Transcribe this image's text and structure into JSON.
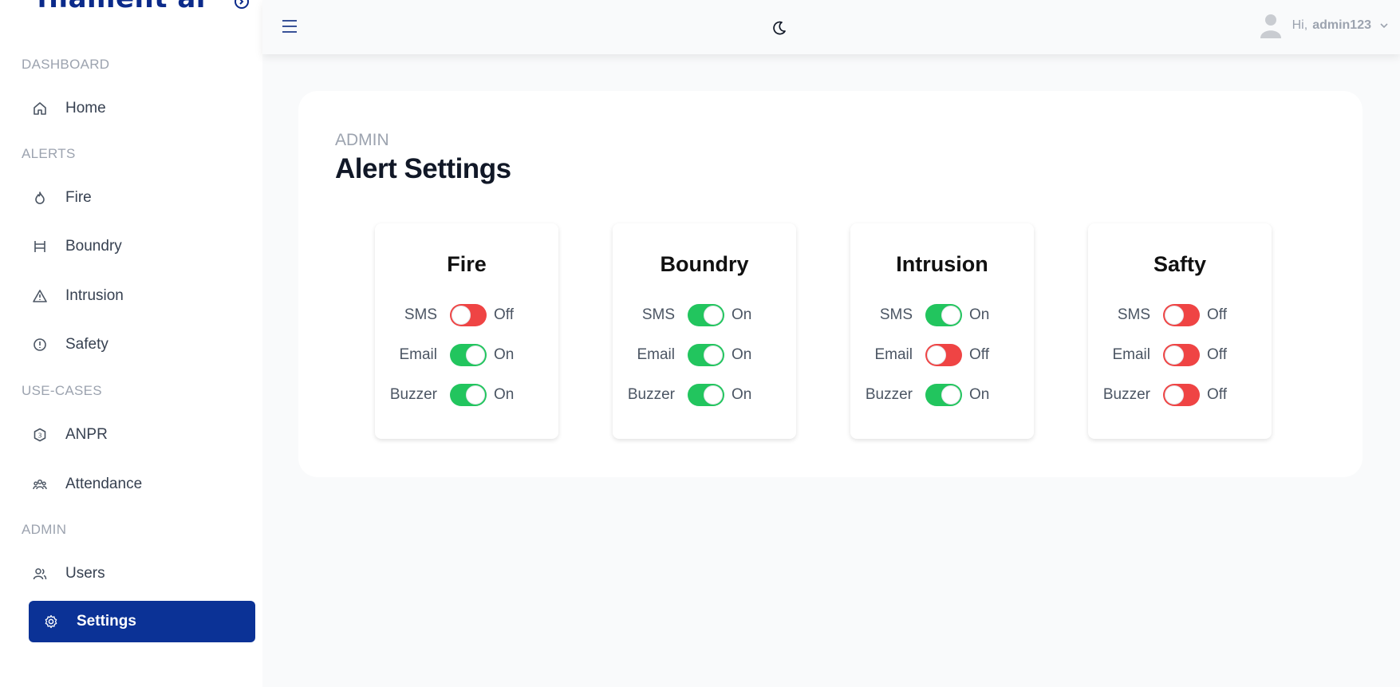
{
  "brand": {
    "name": "filament ai"
  },
  "sidebar": {
    "sections": {
      "dashboard": "DASHBOARD",
      "alerts": "ALERTS",
      "usecases": "USE-CASES",
      "admin": "ADMIN"
    },
    "items": {
      "home": "Home",
      "fire": "Fire",
      "boundry": "Boundry",
      "intrusion": "Intrusion",
      "safety": "Safety",
      "anpr": "ANPR",
      "attendance": "Attendance",
      "users": "Users",
      "settings": "Settings"
    },
    "active_item": "settings"
  },
  "topbar": {
    "greeting": "Hi,",
    "username": "admin123"
  },
  "page": {
    "breadcrumb": "ADMIN",
    "title": "Alert Settings"
  },
  "alert_cards": [
    {
      "title": "Fire",
      "rows": [
        {
          "label": "SMS",
          "state": "Off",
          "on": false
        },
        {
          "label": "Email",
          "state": "On",
          "on": true
        },
        {
          "label": "Buzzer",
          "state": "On",
          "on": true
        }
      ]
    },
    {
      "title": "Boundry",
      "rows": [
        {
          "label": "SMS",
          "state": "On",
          "on": true
        },
        {
          "label": "Email",
          "state": "On",
          "on": true
        },
        {
          "label": "Buzzer",
          "state": "On",
          "on": true
        }
      ]
    },
    {
      "title": "Intrusion",
      "rows": [
        {
          "label": "SMS",
          "state": "On",
          "on": true
        },
        {
          "label": "Email",
          "state": "Off",
          "on": false
        },
        {
          "label": "Buzzer",
          "state": "On",
          "on": true
        }
      ]
    },
    {
      "title": "Safty",
      "rows": [
        {
          "label": "SMS",
          "state": "Off",
          "on": false
        },
        {
          "label": "Email",
          "state": "Off",
          "on": false
        },
        {
          "label": "Buzzer",
          "state": "Off",
          "on": false
        }
      ]
    }
  ],
  "colors": {
    "brand": "#0b2a8a",
    "active_nav": "#0b3296",
    "toggle_on": "#22c55e",
    "toggle_off": "#ef4444"
  },
  "icons": {
    "home": "home-icon",
    "fire": "fire-icon",
    "boundry": "fence-icon",
    "intrusion": "warning-triangle-icon",
    "safety": "alert-circle-icon",
    "anpr": "hexagon-number-icon",
    "attendance": "group-icon",
    "users": "users-icon",
    "settings": "gear-icon"
  }
}
